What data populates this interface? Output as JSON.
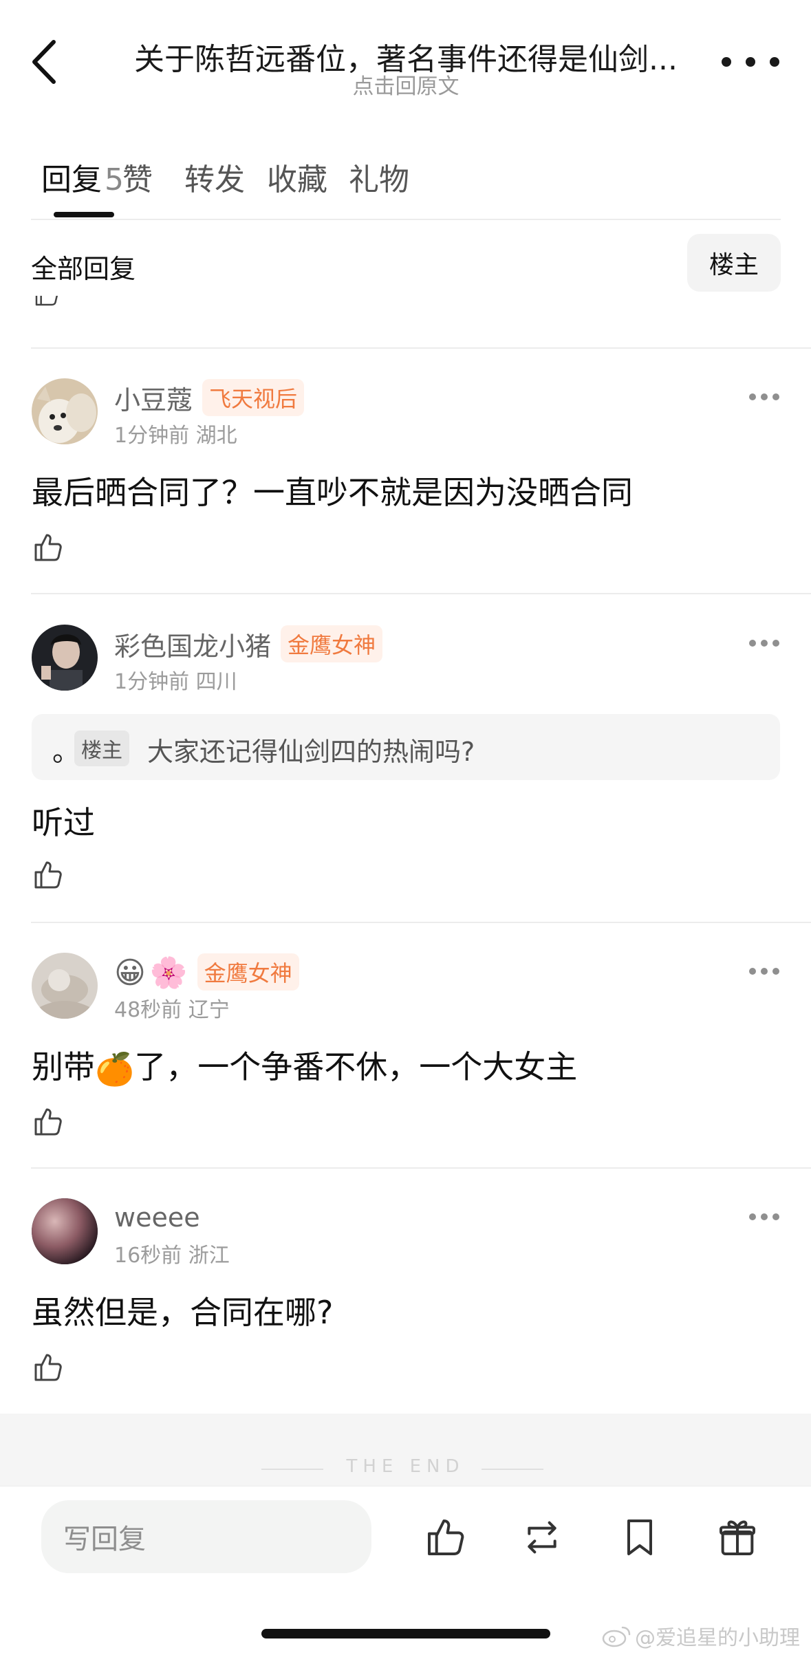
{
  "header": {
    "title": "关于陈哲远番位，著名事件还得是仙剑...",
    "subtitle": "点击回原文"
  },
  "tabs": [
    {
      "label": "回复",
      "count": "5",
      "active": true
    },
    {
      "label": "赞"
    },
    {
      "label": "转发"
    },
    {
      "label": "收藏"
    },
    {
      "label": "礼物"
    }
  ],
  "filter": {
    "label": "全部回复",
    "op_button": "楼主"
  },
  "comments": [
    {
      "username": "小豆蔻",
      "badge": "飞天视后",
      "time": "1分钟前",
      "location": "湖北",
      "text": "最后晒合同了？一直吵不就是因为没晒合同"
    },
    {
      "username": "彩色国龙小猪",
      "badge": "金鹰女神",
      "time": "1分钟前",
      "location": "四川",
      "quote": {
        "prefix": "。",
        "tag": "楼主",
        "text": "大家还记得仙剑四的热闹吗?"
      },
      "text": "听过"
    },
    {
      "username_emojis": [
        "😀",
        "🌸"
      ],
      "badge": "金鹰女神",
      "time": "48秒前",
      "location": "辽宁",
      "text_before": "别带",
      "text_emoji": "🍊",
      "text_after": "了，一个争番不休，一个大女主"
    },
    {
      "username": "weeee",
      "time": "16秒前",
      "location": "浙江",
      "text": "虽然但是，合同在哪?"
    }
  ],
  "end_text": "THE END",
  "bottom_bar": {
    "reply_placeholder": "写回复"
  },
  "watermark": "@爱追星的小助理",
  "colors": {
    "badge_text": "#f07a3f",
    "badge_bg": "#fff1ea",
    "reply_input_bg": "#f3f4f3"
  }
}
